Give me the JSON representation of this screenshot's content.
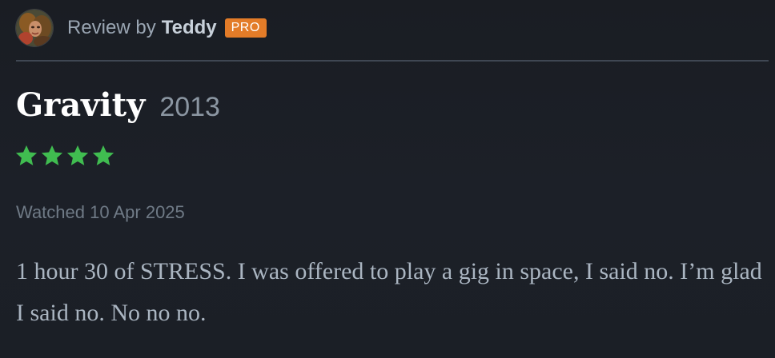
{
  "header": {
    "avatar_icon": "user-avatar",
    "review_by_prefix": "Review by",
    "username": "Teddy",
    "badge": "PRO",
    "badge_color": "#e37c28"
  },
  "film": {
    "title": "Gravity",
    "year": "2013"
  },
  "rating": {
    "stars": 4,
    "max_stars": 5,
    "star_color": "#40bc50",
    "star_icon": "star-icon"
  },
  "watched": "Watched 10 Apr 2025",
  "review": {
    "text": "1 hour 30 of STRESS. I was offered to play a gig in space, I said no. I’m glad I said no. No no no."
  }
}
